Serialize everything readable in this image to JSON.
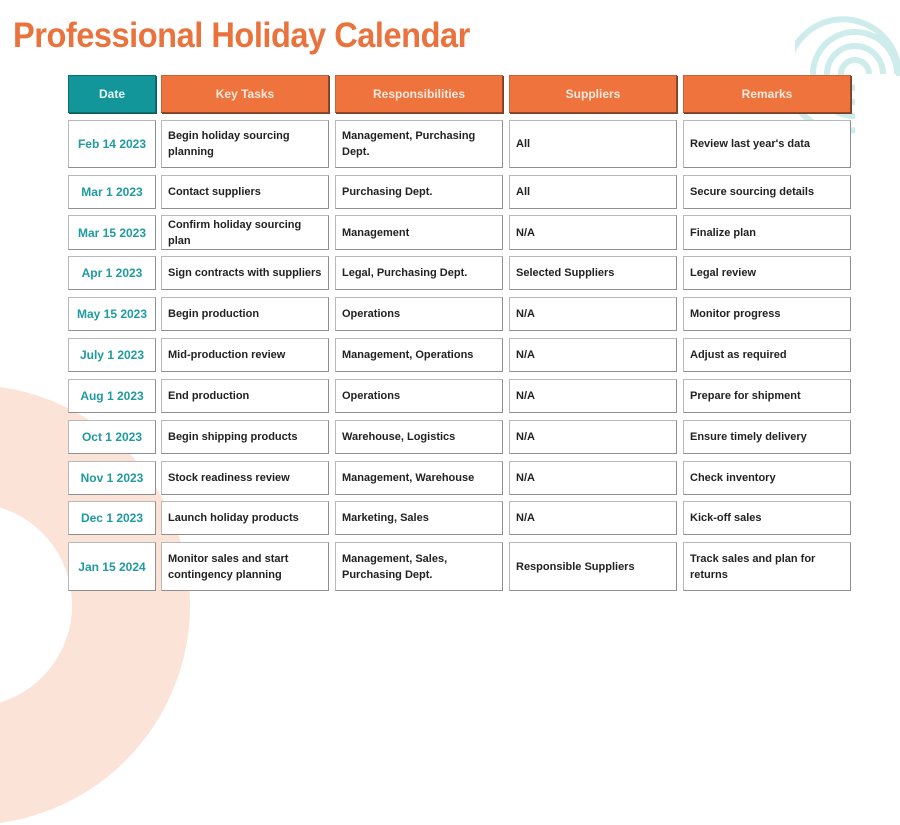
{
  "title": "Professional Holiday Calendar",
  "colors": {
    "title": "#ea733d",
    "date_header": "#13969a",
    "column_header": "#ef733d",
    "date_text": "#1f9aa0",
    "decoration_ring": "#fbe3d8",
    "decoration_spiral": "#cdeceb"
  },
  "decorations": {
    "top_right": "concentric-spiral-icon",
    "bottom_left": "ring-arc-shape"
  },
  "table": {
    "headers": [
      "Date",
      "Key Tasks",
      "Responsibilities",
      "Suppliers",
      "Remarks"
    ],
    "rows": [
      [
        "Feb 14 2023",
        "Begin holiday sourcing planning",
        "Management, Purchasing Dept.",
        "All",
        "Review last year's data"
      ],
      [
        "Mar 1 2023",
        "Contact suppliers",
        "Purchasing Dept.",
        "All",
        "Secure sourcing details"
      ],
      [
        "Mar 15 2023",
        "Confirm holiday sourcing plan",
        "Management",
        "N/A",
        "Finalize plan"
      ],
      [
        "Apr 1 2023",
        "Sign contracts with suppliers",
        "Legal, Purchasing Dept.",
        "Selected Suppliers",
        "Legal review"
      ],
      [
        "May 15 2023",
        "Begin production",
        "Operations",
        "N/A",
        "Monitor progress"
      ],
      [
        "July 1 2023",
        "Mid-production review",
        "Management, Operations",
        "N/A",
        "Adjust as required"
      ],
      [
        "Aug 1 2023",
        "End production",
        "Operations",
        "N/A",
        "Prepare for shipment"
      ],
      [
        "Oct 1 2023",
        "Begin shipping products",
        "Warehouse, Logistics",
        "N/A",
        "Ensure timely delivery"
      ],
      [
        "Nov 1 2023",
        "Stock readiness review",
        "Management, Warehouse",
        "N/A",
        "Check inventory"
      ],
      [
        "Dec 1 2023",
        "Launch holiday products",
        "Marketing, Sales",
        "N/A",
        "Kick-off sales"
      ],
      [
        "Jan 15 2024",
        "Monitor sales and start contingency planning",
        "Management, Sales, Purchasing Dept.",
        "Responsible Suppliers",
        "Track sales and plan for returns"
      ]
    ]
  }
}
